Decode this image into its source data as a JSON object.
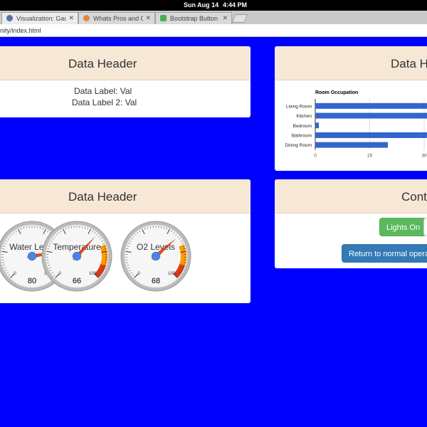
{
  "system_bar": {
    "date": "Sun Aug 14",
    "time": "4:44 PM"
  },
  "browser": {
    "tabs": [
      {
        "label": "Visualization: Gauge",
        "icon": "page-icon",
        "icon_color": "#5a6ea8"
      },
      {
        "label": "Whats Pros and Cons",
        "icon": "site-icon",
        "icon_color": "#e0883a"
      },
      {
        "label": "Bootstrap Button Group",
        "icon": "w3-icon",
        "icon_color": "#4caf50"
      }
    ],
    "url": "nity/index.html"
  },
  "panels": {
    "data_labels": {
      "title": "Data Header",
      "label_1": "Data Label: Val",
      "label_2": "Data Label 2: Val"
    },
    "chart": {
      "title": "Data H"
    },
    "gauges": {
      "title": "Data Header",
      "items": [
        {
          "label": "Water Level",
          "value": 80
        },
        {
          "label": "Temperature",
          "value": 66
        },
        {
          "label": "O2 Levels",
          "value": 68
        }
      ],
      "min_label": "0",
      "max_label": "100"
    },
    "controls": {
      "title": "Cont",
      "lights_on": "Lights On",
      "return_normal": "Return to normal operation"
    }
  },
  "chart_data": {
    "type": "bar",
    "title": "Room Occupation",
    "categories": [
      "Living Room",
      "Kitchen",
      "Bedroom",
      "Bathroom",
      "Dining Room"
    ],
    "values": [
      40,
      40,
      1,
      40,
      20
    ],
    "x_ticks": [
      "0",
      "15",
      "30"
    ],
    "xlim": [
      0,
      30
    ],
    "bar_color": "#3366cc",
    "grid": true
  }
}
